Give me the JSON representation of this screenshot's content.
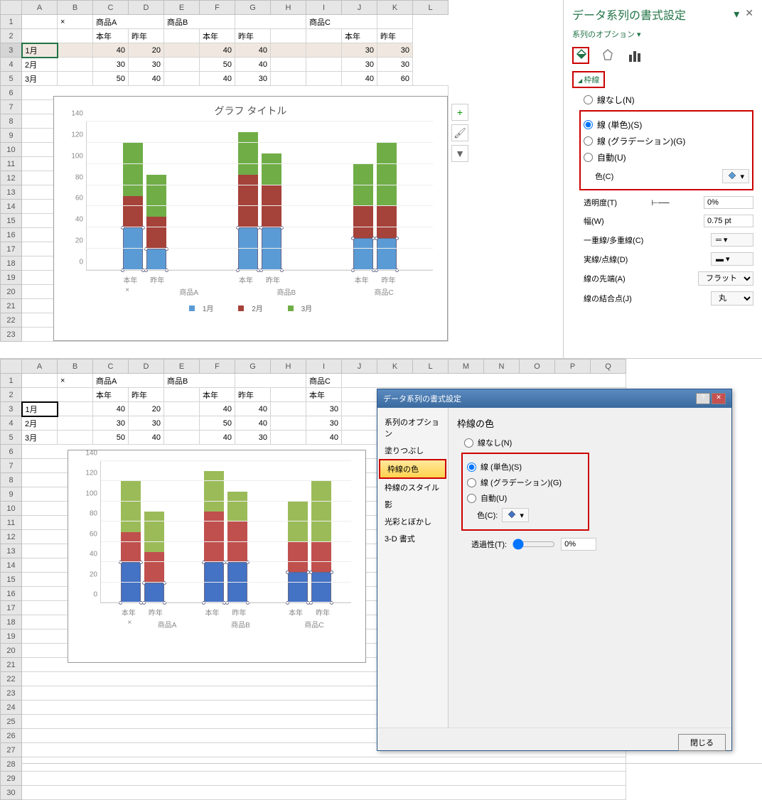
{
  "spreadsheet": {
    "columns": [
      "A",
      "B",
      "C",
      "D",
      "E",
      "F",
      "G",
      "H",
      "I",
      "J",
      "K",
      "L"
    ],
    "rows": [
      1,
      2,
      3,
      4,
      5,
      6,
      7,
      8,
      9,
      10,
      11,
      12,
      13,
      14,
      15,
      16,
      17,
      18,
      19,
      20,
      21,
      22,
      23
    ],
    "corner_x": "×",
    "products": [
      "商品A",
      "商品B",
      "商品C"
    ],
    "years": [
      "本年",
      "昨年",
      "本年",
      "昨年",
      "本年",
      "昨年"
    ],
    "months": [
      "1月",
      "2月",
      "3月"
    ],
    "data": [
      [
        40,
        20,
        null,
        40,
        40,
        null,
        null,
        null,
        30,
        30
      ],
      [
        30,
        30,
        null,
        50,
        40,
        null,
        null,
        null,
        30,
        30
      ],
      [
        50,
        40,
        null,
        40,
        30,
        null,
        null,
        null,
        40,
        60
      ]
    ]
  },
  "chart_data": {
    "type": "bar",
    "stacked": true,
    "title": "グラフ タイトル",
    "yticks": [
      0,
      20,
      40,
      60,
      80,
      100,
      120,
      140
    ],
    "ymax": 140,
    "groups": [
      "商品A",
      "商品B",
      "商品C"
    ],
    "subgroups": [
      "本年",
      "昨年"
    ],
    "series": [
      {
        "name": "1月",
        "color_top": "#5b9bd5",
        "color_bottom": "#4472c4",
        "values": {
          "商品A": {
            "本年": 40,
            "昨年": 20
          },
          "商品B": {
            "本年": 40,
            "昨年": 40
          },
          "商品C": {
            "本年": 30,
            "昨年": 30
          }
        }
      },
      {
        "name": "2月",
        "color_top": "#a5423a",
        "color_bottom": "#c0504d",
        "values": {
          "商品A": {
            "本年": 30,
            "昨年": 30
          },
          "商品B": {
            "本年": 50,
            "昨年": 40
          },
          "商品C": {
            "本年": 30,
            "昨年": 30
          }
        }
      },
      {
        "name": "3月",
        "color_top": "#70ad47",
        "color_bottom": "#9bbb59",
        "values": {
          "商品A": {
            "本年": 50,
            "昨年": 40
          },
          "商品B": {
            "本年": 40,
            "昨年": 30
          },
          "商品C": {
            "本年": 40,
            "昨年": 60
          }
        }
      }
    ],
    "legend_prefix": "×"
  },
  "format_pane_2013": {
    "title": "データ系列の書式設定",
    "series_option": "系列のオプション",
    "section": "枠線",
    "radios": {
      "none": "線なし(N)",
      "solid": "線 (単色)(S)",
      "gradient": "線 (グラデーション)(G)",
      "auto": "自動(U)"
    },
    "props": {
      "color": "色(C)",
      "transparency": "透明度(T)",
      "transparency_val": "0%",
      "width": "幅(W)",
      "width_val": "0.75 pt",
      "compound": "一重線/多重線(C)",
      "dash": "実線/点線(D)",
      "cap": "線の先端(A)",
      "cap_val": "フラット",
      "join": "線の結合点(J)",
      "join_val": "丸"
    }
  },
  "dialog_2010": {
    "title": "データ系列の書式設定",
    "nav": {
      "series_opt": "系列のオプション",
      "fill": "塗りつぶし",
      "border_color": "枠線の色",
      "border_style": "枠線のスタイル",
      "shadow": "影",
      "glow": "光彩とぼかし",
      "3d": "3-D 書式"
    },
    "content_title": "枠線の色",
    "radios": {
      "none": "線なし(N)",
      "solid": "線 (単色)(S)",
      "gradient": "線 (グラデーション)(G)",
      "auto": "自動(U)"
    },
    "color_label": "色(C):",
    "transparency_label": "透過性(T):",
    "transparency_val": "0%",
    "close_btn": "閉じる"
  },
  "columns_bottom": [
    "A",
    "B",
    "C",
    "D",
    "E",
    "F",
    "G",
    "H",
    "I",
    "J",
    "K",
    "L",
    "M",
    "N",
    "O",
    "P",
    "Q"
  ],
  "rows_bottom": [
    1,
    2,
    3,
    4,
    5,
    6,
    7,
    8,
    9,
    10,
    11,
    12,
    13,
    14,
    15,
    16,
    17,
    18,
    19,
    20,
    21,
    22,
    23,
    24,
    25,
    26,
    27,
    28,
    29,
    30
  ]
}
